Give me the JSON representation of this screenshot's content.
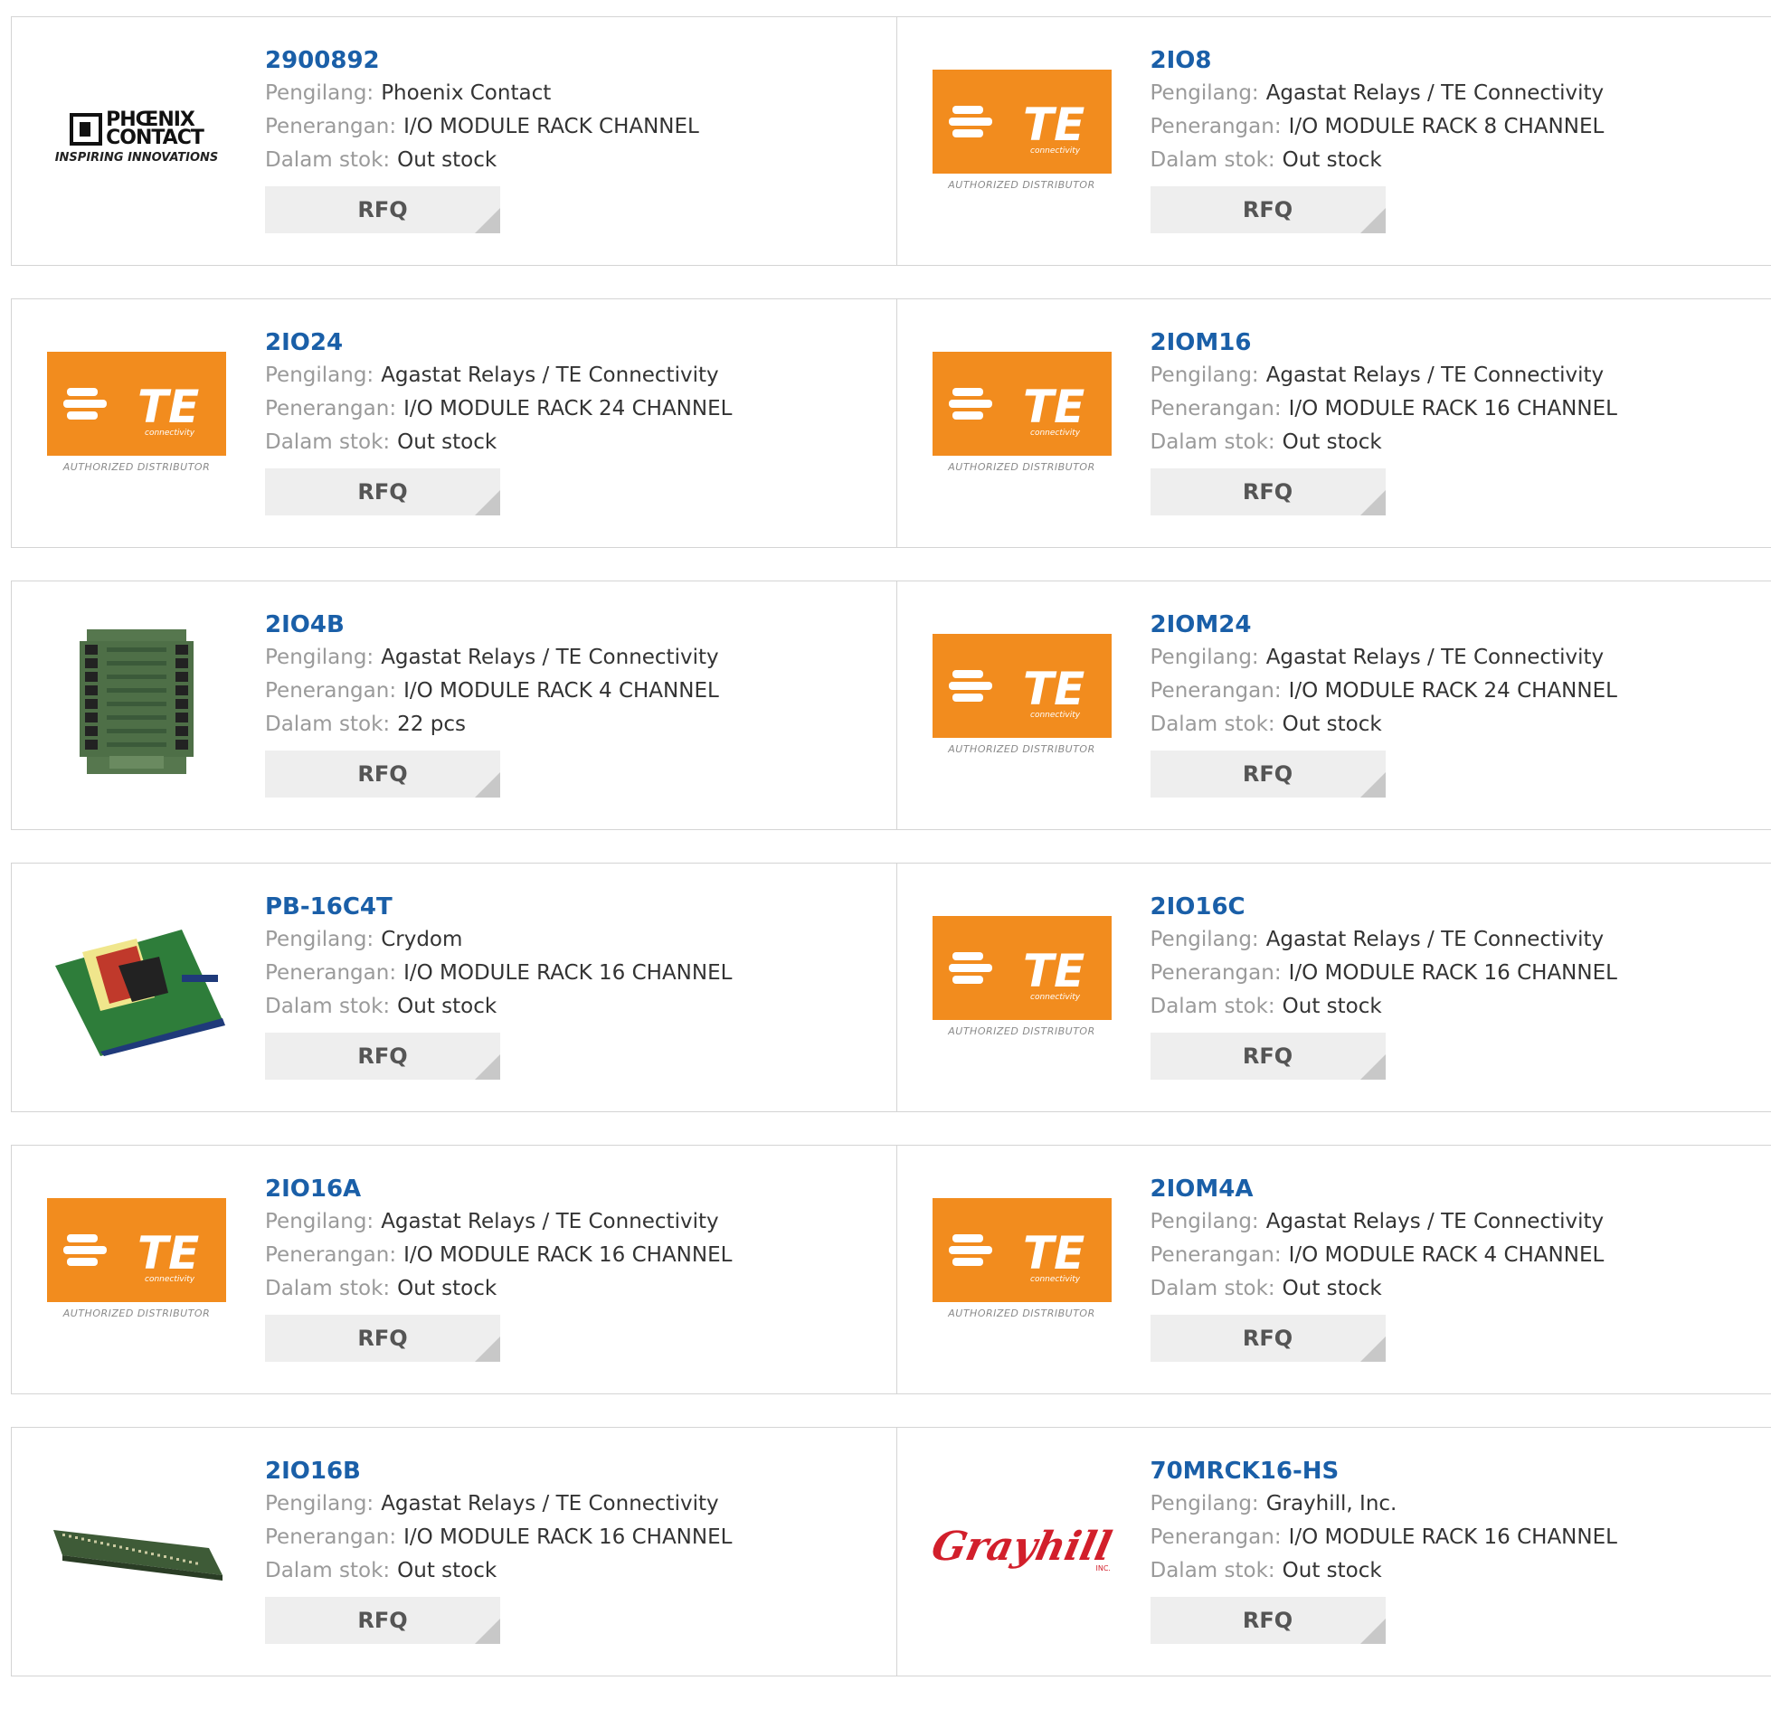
{
  "labels": {
    "manufacturer": "Pengilang:",
    "description": "Penerangan:",
    "stock": "Dalam stok:",
    "rfq": "RFQ"
  },
  "te_logo": {
    "text": "TE",
    "sub": "connectivity",
    "tagline": "AUTHORIZED DISTRIBUTOR"
  },
  "phoenix_logo": {
    "line1": "PHŒNIX",
    "line2": "CONTACT",
    "tagline": "INSPIRING INNOVATIONS"
  },
  "grayhill_logo": {
    "text": "Grayhill",
    "sub": "INC."
  },
  "colors": {
    "part_link": "#1a5fa8",
    "te_orange": "#f28c1e",
    "grayhill_red": "#d21f2b"
  },
  "products": [
    {
      "part": "2900892",
      "manufacturer": "Phoenix Contact",
      "description": "I/O MODULE RACK CHANNEL",
      "stock": "Out stock",
      "image": "phoenix-logo"
    },
    {
      "part": "2IO8",
      "manufacturer": "Agastat Relays / TE Connectivity",
      "description": "I/O MODULE RACK 8 CHANNEL",
      "stock": "Out stock",
      "image": "te-logo"
    },
    {
      "part": "2IO24",
      "manufacturer": "Agastat Relays / TE Connectivity",
      "description": "I/O MODULE RACK 24 CHANNEL",
      "stock": "Out stock",
      "image": "te-logo"
    },
    {
      "part": "2IOM16",
      "manufacturer": "Agastat Relays / TE Connectivity",
      "description": "I/O MODULE RACK 16 CHANNEL",
      "stock": "Out stock",
      "image": "te-logo"
    },
    {
      "part": "2IO4B",
      "manufacturer": "Agastat Relays / TE Connectivity",
      "description": "I/O MODULE RACK 4 CHANNEL",
      "stock": "22 pcs",
      "image": "green-pcb-board"
    },
    {
      "part": "2IOM24",
      "manufacturer": "Agastat Relays / TE Connectivity",
      "description": "I/O MODULE RACK 24 CHANNEL",
      "stock": "Out stock",
      "image": "te-logo"
    },
    {
      "part": "PB-16C4T",
      "manufacturer": "Crydom",
      "description": "I/O MODULE RACK 16 CHANNEL",
      "stock": "Out stock",
      "image": "relay-rack-photo"
    },
    {
      "part": "2IO16C",
      "manufacturer": "Agastat Relays / TE Connectivity",
      "description": "I/O MODULE RACK 16 CHANNEL",
      "stock": "Out stock",
      "image": "te-logo"
    },
    {
      "part": "2IO16A",
      "manufacturer": "Agastat Relays / TE Connectivity",
      "description": "I/O MODULE RACK 16 CHANNEL",
      "stock": "Out stock",
      "image": "te-logo"
    },
    {
      "part": "2IOM4A",
      "manufacturer": "Agastat Relays / TE Connectivity",
      "description": "I/O MODULE RACK 4 CHANNEL",
      "stock": "Out stock",
      "image": "te-logo"
    },
    {
      "part": "2IO16B",
      "manufacturer": "Agastat Relays / TE Connectivity",
      "description": "I/O MODULE RACK 16 CHANNEL",
      "stock": "Out stock",
      "image": "long-pcb-board"
    },
    {
      "part": "70MRCK16-HS",
      "manufacturer": "Grayhill, Inc.",
      "description": "I/O MODULE RACK 16 CHANNEL",
      "stock": "Out stock",
      "image": "grayhill-logo"
    }
  ]
}
